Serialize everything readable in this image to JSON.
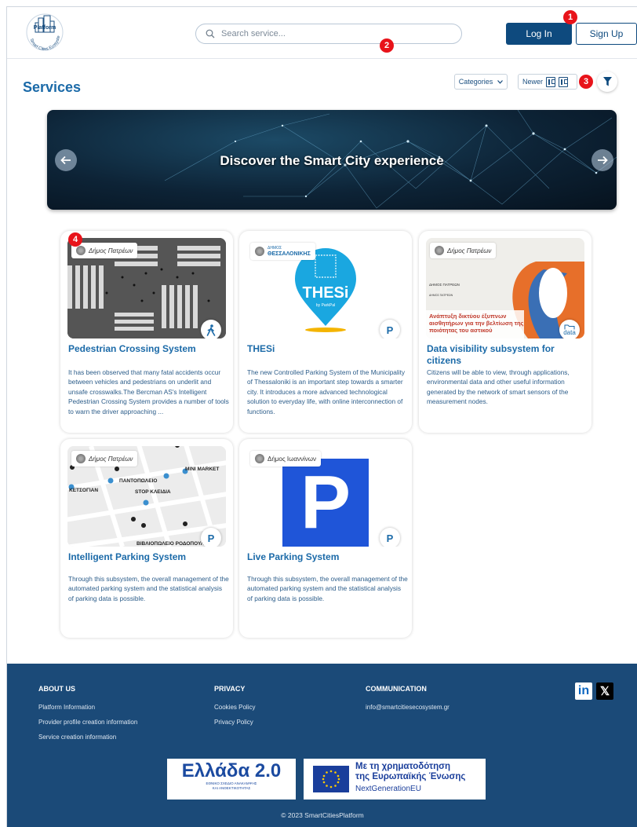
{
  "header": {
    "logo_text_top": "Platform",
    "logo_text_ring": "Smart Cities Ecosystem",
    "search_placeholder": "Search service...",
    "login_label": "Log In",
    "signup_label": "Sign Up"
  },
  "markers": [
    "1",
    "2",
    "3",
    "4"
  ],
  "toolbar": {
    "title": "Services",
    "categories_label": "Categories",
    "sort_label": "Newer"
  },
  "banner": {
    "text": "Discover the Smart City experience"
  },
  "cards": [
    {
      "title": "Pedestrian Crossing System",
      "municipality": "Δήμος Πατρέων",
      "description": "It has been observed that many fatal accidents occur between vehicles and pedestrians on underlit and unsafe crosswalks.The Bercman AS's Intelligent Pedestrian Crossing System provides a number of tools to warn the driver approaching ...",
      "badge_icon": "pedestrian-icon"
    },
    {
      "title": "THESi",
      "municipality": "ΔΗΜΟΣ ΘΕΣΣΑΛΟΝΙΚΗΣ",
      "municipality_small": "ΔΗΜΟΣ",
      "municipality_main": "ΘΕΣΣΑΛΟΝΙΚΗΣ",
      "image_text": "THESi",
      "image_subtext": "by ParkPal",
      "description": "The new Controlled Parking System of the Municipality of Thessaloniki is an important step towards a smarter city. It introduces a more advanced technological solution to everyday life, with online interconnection of functions.",
      "badge_text": "P"
    },
    {
      "title": "Data visibility subsystem for citizens",
      "municipality": "Δήμος Πατρέων",
      "image_text_1": "ΔΗΜΟΣ ΠΑΤΡΕΩΝ",
      "image_text_2": "ΔΗΜΟΣ ΠΑΤΡΕΩΝ",
      "image_caption": "Ανάπτυξη δικτύου έξυπνων αισθητήρων για την βελτίωση της ποιότητας του αστικού",
      "description": "Citizens will be able to view, through applications, environmental data and other useful information generated by the network of smart sensors of the measurement nodes.",
      "badge_text": "data"
    },
    {
      "title": "Intelligent Parking System",
      "municipality": "Δήμος Πατρέων",
      "map_labels": [
        "MINI MARKET",
        "ΠΑΝΤΟΠΩΛΕΙΟ",
        "ΚΕΤΣΟΓΙΑΝ",
        "STOP ΚΛΕΙΔΙΑ",
        "ΒΙΒΛΙΟΠΩΛΕΙΟ ΡΟΔΟΠΟΥΛΟΣ"
      ],
      "description": "Through this subsystem, the overall management of the automated parking system and the statistical analysis of parking data is possible.",
      "badge_text": "P"
    },
    {
      "title": "Live Parking System",
      "municipality": "Δήμος Ιωαννίνων",
      "image_text": "P",
      "description": "Through this subsystem, the overall management of the automated parking system and the statistical analysis of parking data is possible.",
      "badge_text": "P"
    }
  ],
  "footer": {
    "about_heading": "ABOUT US",
    "about_links": [
      "Platform Information",
      "Provider profile creation information",
      "Service creation information"
    ],
    "privacy_heading": "PRIVACY",
    "privacy_links": [
      "Cookies Policy",
      "Privacy Policy"
    ],
    "communication_heading": "COMMUNICATION",
    "email": "info@smartcitiesecosystem.gr",
    "linkedin_label": "in",
    "x_label": "𝕏",
    "greece_logo": "Ελλάδα 2.0",
    "greece_sub_1": "ΕΘΝΙΚΟ ΣΧΕΔΙΟ ΑΝΑΚΑΜΨΗΣ",
    "greece_sub_2": "ΚΑΙ ΑΝΘΕΚΤΙΚΟΤΗΤΑΣ",
    "eu_line_1": "Με τη χρηματοδότηση",
    "eu_line_2": "της Ευρωπαϊκής Ένωσης",
    "eu_line_3": "NextGenerationEU",
    "copyright": "© 2023 SmartCitiesPlatform"
  },
  "colors": {
    "primary": "#0e4a7e",
    "accent": "#1b6aa8",
    "footer_bg": "#1b4a78",
    "marker": "#e8131a"
  }
}
